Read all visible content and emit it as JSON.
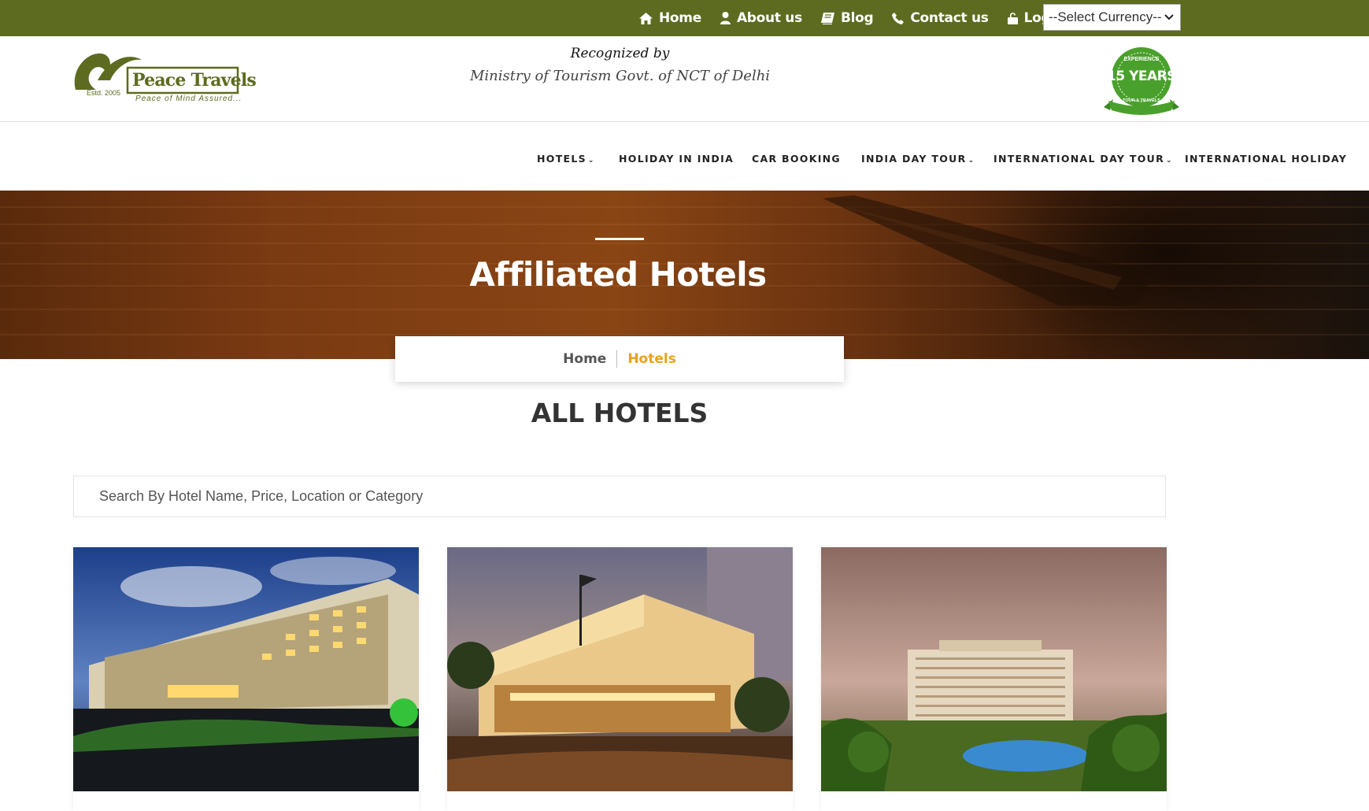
{
  "topbar": {
    "links": [
      {
        "label": "Home",
        "icon": "home-icon"
      },
      {
        "label": "About us",
        "icon": "user-icon"
      },
      {
        "label": "Blog",
        "icon": "book-icon"
      },
      {
        "label": "Contact us",
        "icon": "phone-icon"
      },
      {
        "label": "Login",
        "icon": "lock-icon"
      }
    ],
    "currency_select": "--Select Currency--",
    "bg_color": "#5c6b20"
  },
  "header": {
    "logo_name": "Peace Travels",
    "logo_estd": "Estd. 2005",
    "logo_tagline": "Peace of Mind Assured...",
    "recognized_line1": "Recognized by",
    "recognized_line2": "Ministry of Tourism Govt. of NCT of Delhi",
    "badge_top": "EXPERIENCE",
    "badge_main": "15 YEARS",
    "badge_bottom": "TOUR & TRAVELS"
  },
  "mainnav": {
    "items": [
      {
        "label": "HOTELS",
        "dropdown": true
      },
      {
        "label": "HOLIDAY IN INDIA",
        "dropdown": false
      },
      {
        "label": "CAR BOOKING",
        "dropdown": false
      },
      {
        "label": "INDIA DAY TOUR",
        "dropdown": true
      },
      {
        "label": "INTERNATIONAL DAY TOUR",
        "dropdown": true
      },
      {
        "label": "INTERNATIONAL HOLIDAY",
        "dropdown": false
      }
    ]
  },
  "hero": {
    "title": "Affiliated Hotels"
  },
  "breadcrumb": {
    "home": "Home",
    "current": "Hotels",
    "current_color": "#e8a317"
  },
  "section": {
    "title": "ALL HOTELS"
  },
  "search": {
    "placeholder": "Search By Hotel Name, Price, Location or Category"
  }
}
